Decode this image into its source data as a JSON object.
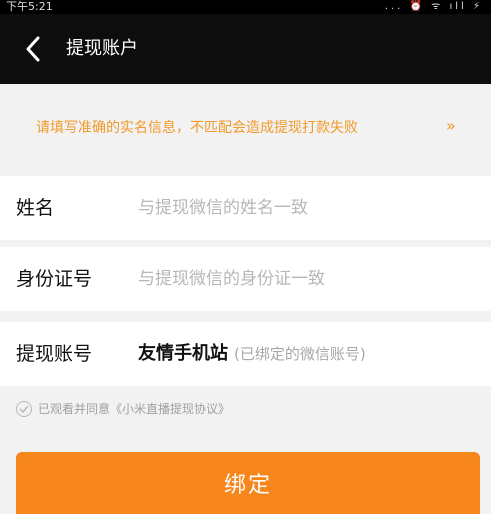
{
  "status_bar": {
    "time": "下午5:21",
    "icons": "... ⏰ ᯤ ıll ⚡"
  },
  "nav": {
    "title": "提现账户"
  },
  "notice": {
    "text": "请填写准确的实名信息，不匹配会造成提现打款失败",
    "arrow": "»"
  },
  "form": {
    "name": {
      "label": "姓名",
      "placeholder": "与提现微信的姓名一致"
    },
    "id_number": {
      "label": "身份证号",
      "placeholder": "与提现微信的身份证一致"
    },
    "account": {
      "label": "提现账号",
      "value": "友情手机站",
      "hint": "(已绑定的微信账号)"
    }
  },
  "agreement": {
    "text": "已观看并同意《小米直播提现协议》"
  },
  "bind_button": {
    "label": "绑定"
  },
  "colors": {
    "accent": "#f7861c",
    "notice": "#f19a2a",
    "header": "#0d0d0d"
  }
}
